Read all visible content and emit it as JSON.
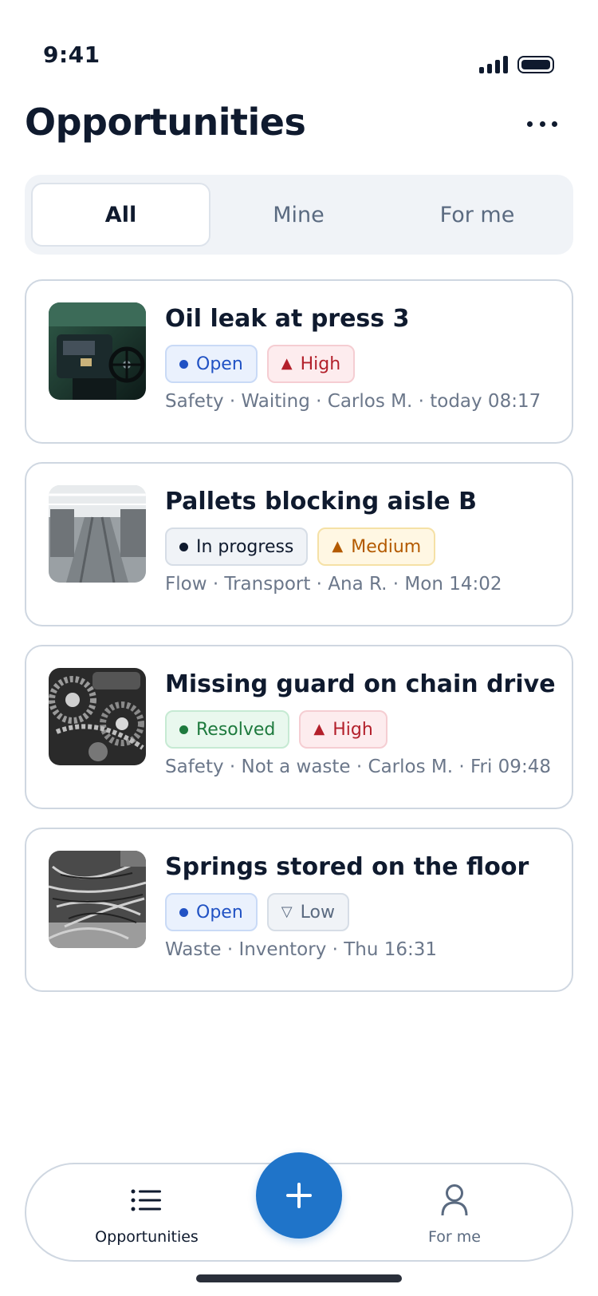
{
  "status_bar": {
    "time": "9:41"
  },
  "header": {
    "title": "Opportunities",
    "more_icon": "more-horizontal-icon"
  },
  "tabs": [
    {
      "label": "All",
      "active": true
    },
    {
      "label": "Mine",
      "active": false
    },
    {
      "label": "For me",
      "active": false
    }
  ],
  "items": [
    {
      "title": "Oil leak at press 3",
      "status": "Open",
      "priority": "High",
      "priority_symbol": "▲",
      "meta": "Safety · Waiting · Carlos M. · today 08:17",
      "thumbnail": "industrial-press-photo"
    },
    {
      "title": "Pallets blocking aisle B",
      "status": "In progress",
      "priority": "Medium",
      "priority_symbol": "▲",
      "meta": "Flow · Transport · Ana R. · Mon 14:02",
      "thumbnail": "factory-aisle-photo"
    },
    {
      "title": "Missing guard on chain drive",
      "status": "Resolved",
      "priority": "High",
      "priority_symbol": "▲",
      "meta": "Safety · Not a waste · Carlos M. · Fri 09:48",
      "thumbnail": "chain-drive-photo"
    },
    {
      "title": "Springs stored on the floor",
      "status": "Open",
      "priority": "Low",
      "priority_symbol": "▽",
      "meta": "Waste · Inventory · Thu 16:31",
      "thumbnail": "springs-pile-photo"
    }
  ],
  "bottom_nav": {
    "items": [
      {
        "label": "Opportunities",
        "icon": "list-icon",
        "active": true
      },
      {
        "label": "For me",
        "icon": "user-icon",
        "active": false
      }
    ],
    "fab_icon": "plus-icon"
  },
  "colors": {
    "accent": "#1f74c9",
    "text": "#0f1a2e",
    "open": "#2152c4",
    "resolved": "#1e7a3e",
    "high": "#b3202b",
    "medium": "#b35a00"
  }
}
